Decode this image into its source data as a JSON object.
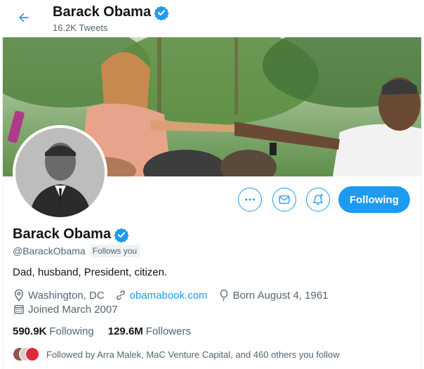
{
  "header": {
    "name": "Barack Obama",
    "tweet_count": "16.2K Tweets"
  },
  "profile": {
    "name": "Barack Obama",
    "handle": "@BarackObama",
    "follows_you": "Follows you",
    "bio": "Dad, husband, President, citizen.",
    "location": "Washington, DC",
    "website": "obamabook.com",
    "birthday": "Born August 4, 1961",
    "joined": "Joined March 2007"
  },
  "actions": {
    "following_label": "Following",
    "more_icon": "more-icon",
    "message_icon": "envelope-icon",
    "notify_icon": "bell-plus-icon"
  },
  "stats": {
    "following_count": "590.9K",
    "following_label": "Following",
    "followers_count": "129.6M",
    "followers_label": "Followers"
  },
  "followed_by": {
    "text": "Followed by Arra Malek, MaC Venture Capital, and 460 others you follow"
  },
  "colors": {
    "accent": "#1d9bf0",
    "verified": "#1d9bf0",
    "secondary_text": "#536471"
  }
}
